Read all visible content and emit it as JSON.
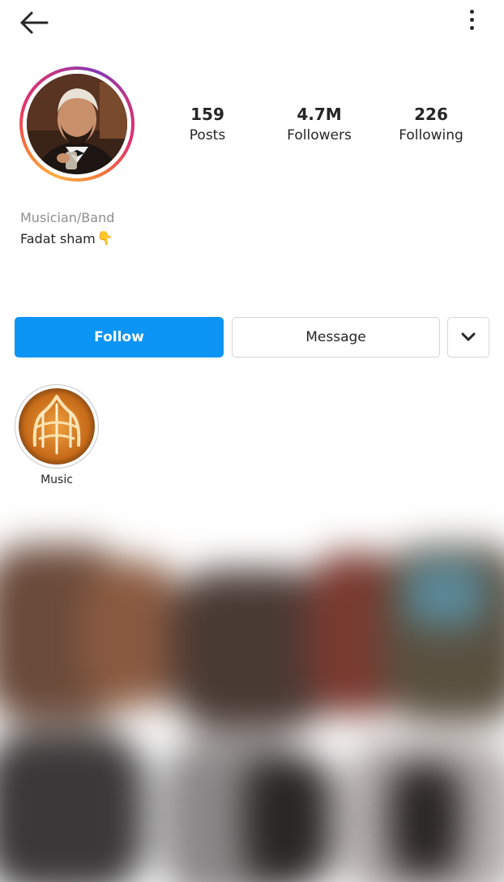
{
  "profile": {
    "category": "Musician/Band",
    "bio_text": "Fadat sham",
    "bio_emoji": "👇"
  },
  "stats": [
    {
      "value": "159",
      "label": "Posts"
    },
    {
      "value": "4.7M",
      "label": "Followers"
    },
    {
      "value": "226",
      "label": "Following"
    }
  ],
  "actions": {
    "follow_label": "Follow",
    "message_label": "Message"
  },
  "highlights": [
    {
      "label": "Music"
    }
  ],
  "colors": {
    "follow_button": "#0d95f6",
    "story_ring": "#e1306c",
    "text": "#262626",
    "muted": "#8e8e8e"
  },
  "icons": {
    "back": "arrow-left-icon",
    "more": "more-vertical-icon",
    "dropdown": "chevron-down-icon"
  }
}
